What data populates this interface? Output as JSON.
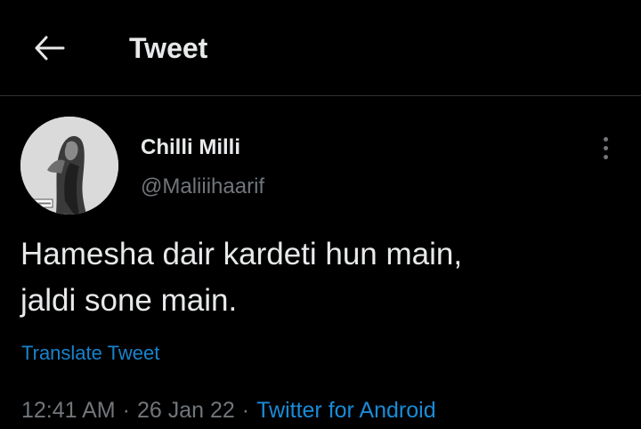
{
  "header": {
    "back_icon": "arrow-left-icon",
    "title": "Tweet"
  },
  "tweet": {
    "avatar_icon": "profile-photo",
    "display_name": "Chilli Milli",
    "handle": "@Maliiihaarif",
    "more_icon": "more-vertical-icon",
    "text_lines": [
      "Hamesha dair kardeti hun main,",
      "jaldi sone main."
    ],
    "translate_label": "Translate Tweet",
    "time": "12:41 AM",
    "separator": "·",
    "date": "26 Jan 22",
    "source": "Twitter for Android"
  },
  "colors": {
    "background": "#000000",
    "primary_text": "#e7e9ea",
    "secondary_text": "#71767b",
    "link": "#1d9bf0",
    "divider": "#2f3336"
  }
}
